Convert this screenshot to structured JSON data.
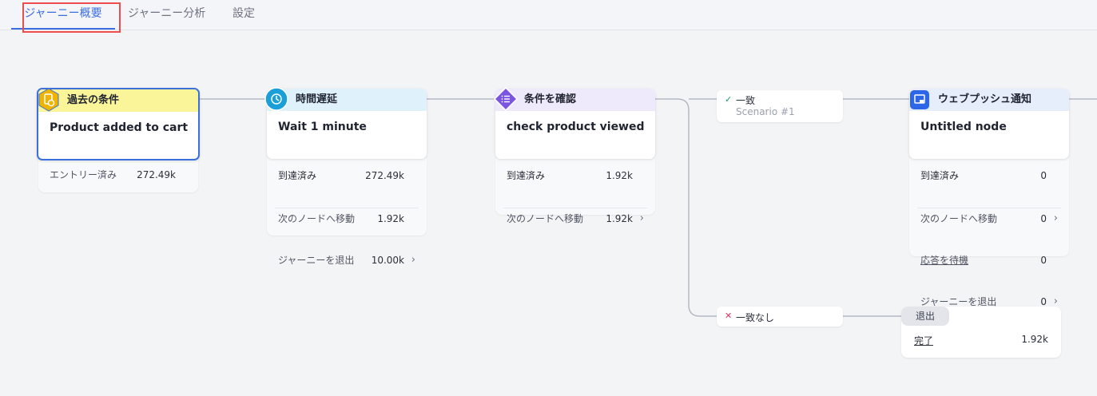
{
  "tabs": [
    {
      "label": "ジャーニー概要"
    },
    {
      "label": "ジャーニー分析"
    },
    {
      "label": "設定"
    }
  ],
  "colors": {
    "accent": "#3b6ee0",
    "highlight_box": "#ee4d4d",
    "entry_header": "#fbf59a",
    "delay_header": "#dff1fb",
    "condition_header": "#efeafb",
    "push_header": "#e6eefc",
    "match_check": "#1f9a6a",
    "nomatch_x": "#e0355e"
  },
  "nodes": {
    "entry": {
      "icon": "document-clock-icon",
      "header": "過去の条件",
      "title": "Product added to cart",
      "stats": [
        {
          "label": "エントリー済み",
          "value": "272.49k"
        }
      ]
    },
    "delay": {
      "icon": "clock-icon",
      "header": "時間遅延",
      "title": "Wait 1 minute",
      "stats": [
        {
          "label": "到達済み",
          "value": "272.49k"
        },
        {
          "label": "次のノードへ移動",
          "value": "1.92k"
        },
        {
          "label": "ジャーニーを退出",
          "value": "10.00k"
        }
      ]
    },
    "condition": {
      "icon": "list-icon",
      "header": "条件を確認",
      "title": "check product viewed",
      "stats": [
        {
          "label": "到達済み",
          "value": "1.92k"
        },
        {
          "label": "次のノードへ移動",
          "value": "1.92k"
        }
      ]
    },
    "push": {
      "icon": "web-push-icon",
      "header": "ウェブプッシュ通知",
      "title": "Untitled node",
      "stats": [
        {
          "label": "到達済み",
          "value": "0"
        },
        {
          "label": "次のノードへ移動",
          "value": "0"
        },
        {
          "label": "応答を待機",
          "value": "0"
        },
        {
          "label": "ジャーニーを退出",
          "value": "0"
        }
      ]
    }
  },
  "branches": {
    "match": {
      "label": "一致",
      "sub": "Scenario #1",
      "icon": "check-icon"
    },
    "no_match": {
      "label": "一致なし",
      "icon": "x-icon"
    }
  },
  "exit": {
    "chip": "退出",
    "row_label": "完了",
    "row_value": "1.92k"
  }
}
